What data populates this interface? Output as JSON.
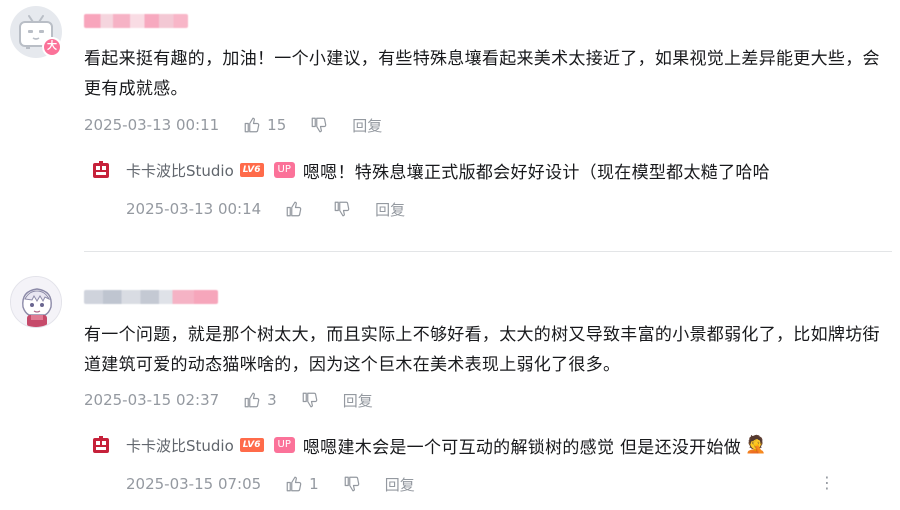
{
  "comments": [
    {
      "text": "看起来挺有趣的，加油！一个小建议，有些特殊息壤看起来美术太接近了，如果视觉上差异能更大些，会更有成就感。",
      "time": "2025-03-13 00:11",
      "likes": "15",
      "reply_label": "回复",
      "badge": "大",
      "reply": {
        "name": "卡卡波比Studio",
        "level": "LV6",
        "up_tag": "UP",
        "text": "嗯嗯！特殊息壤正式版都会好好设计（现在模型都太糙了哈哈",
        "time": "2025-03-13 00:14",
        "likes": "",
        "reply_label": "回复"
      }
    },
    {
      "text": "有一个问题，就是那个树太大，而且实际上不够好看，太大的树又导致丰富的小景都弱化了，比如牌坊街道建筑可爱的动态猫咪啥的，因为这个巨木在美术表现上弱化了很多。",
      "time": "2025-03-15 02:37",
      "likes": "3",
      "reply_label": "回复",
      "reply": {
        "name": "卡卡波比Studio",
        "level": "LV6",
        "up_tag": "UP",
        "text": "嗯嗯建木会是一个可互动的解锁树的感觉 但是还没开始做",
        "emoji": "🤦",
        "time": "2025-03-15 07:05",
        "likes": "1",
        "reply_label": "回复"
      }
    }
  ],
  "icons": {
    "like": "thumbs-up-icon",
    "dislike": "thumbs-down-icon",
    "more": "more-vertical-icon"
  },
  "colors": {
    "up_tag": "#fb7299",
    "level_badge": "#ff6b4a",
    "meta_text": "#9499a0"
  }
}
